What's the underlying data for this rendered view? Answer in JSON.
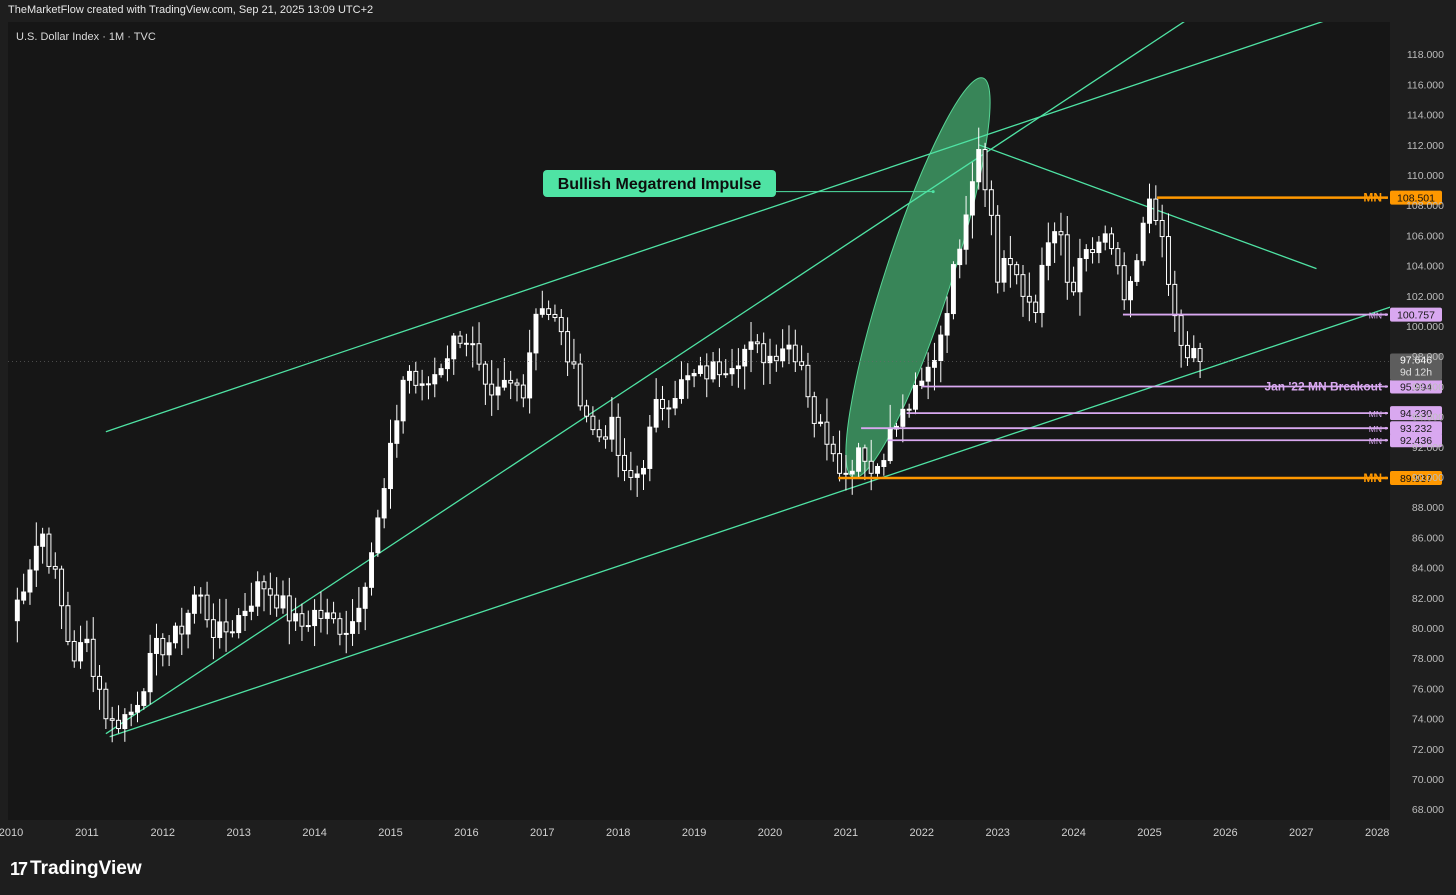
{
  "header": {
    "credit": "TheMarketFlow created with TradingView.com, Sep 21, 2025 13:09 UTC+2"
  },
  "symbol": {
    "title": "U.S. Dollar Index · 1M · TVC"
  },
  "branding": {
    "logo_mark": "17",
    "logo_text": "TradingView"
  },
  "colors": {
    "background": "#161616",
    "candle": "#ffffff",
    "trendline": "#4fe3a4",
    "mn_orange": "#ff9800",
    "mn_pink": "#d9a8f0",
    "ellipse_fill": "#3f9d66"
  },
  "chart_data": {
    "type": "candlestick",
    "title": "U.S. Dollar Index · 1M · TVC",
    "x_ticks": [
      "2010",
      "2011",
      "2012",
      "2013",
      "2014",
      "2015",
      "2016",
      "2017",
      "2018",
      "2019",
      "2020",
      "2021",
      "2022",
      "2023",
      "2024",
      "2025",
      "2026",
      "2027",
      "2028"
    ],
    "y_ticks": [
      "68.000",
      "70.000",
      "72.000",
      "74.000",
      "76.000",
      "78.000",
      "80.000",
      "82.000",
      "84.000",
      "86.000",
      "88.000",
      "90.000",
      "92.000",
      "94.000",
      "96.000",
      "98.000",
      "100.000",
      "102.000",
      "104.000",
      "106.000",
      "108.000",
      "110.000",
      "112.000",
      "114.000",
      "116.000",
      "118.000",
      "120.000"
    ],
    "ylim": [
      67.5,
      120.3
    ],
    "last_price": {
      "value": "97.646",
      "countdown": "9d 12h"
    },
    "anchors": [
      [
        2010.0,
        80.5
      ],
      [
        2010.4,
        86.5
      ],
      [
        2010.6,
        83.0
      ],
      [
        2010.8,
        78.0
      ],
      [
        2011.0,
        79.0
      ],
      [
        2011.3,
        73.5
      ],
      [
        2011.6,
        74.5
      ],
      [
        2011.9,
        78.5
      ],
      [
        2012.2,
        79.5
      ],
      [
        2012.45,
        82.5
      ],
      [
        2012.7,
        79.5
      ],
      [
        2012.9,
        80.0
      ],
      [
        2013.3,
        83.0
      ],
      [
        2013.5,
        82.0
      ],
      [
        2013.8,
        80.0
      ],
      [
        2014.0,
        81.0
      ],
      [
        2014.4,
        80.0
      ],
      [
        2014.5,
        80.5
      ],
      [
        2014.7,
        84.0
      ],
      [
        2014.9,
        88.5
      ],
      [
        2015.2,
        97.5
      ],
      [
        2015.4,
        95.5
      ],
      [
        2015.6,
        97.0
      ],
      [
        2015.9,
        99.5
      ],
      [
        2016.05,
        99.0
      ],
      [
        2016.3,
        94.5
      ],
      [
        2016.5,
        96.0
      ],
      [
        2016.75,
        96.0
      ],
      [
        2016.95,
        102.0
      ],
      [
        2017.2,
        100.0
      ],
      [
        2017.5,
        95.5
      ],
      [
        2017.7,
        92.5
      ],
      [
        2017.9,
        93.5
      ],
      [
        2018.1,
        89.5
      ],
      [
        2018.3,
        90.5
      ],
      [
        2018.5,
        94.5
      ],
      [
        2018.8,
        96.0
      ],
      [
        2018.95,
        96.5
      ],
      [
        2019.3,
        97.2
      ],
      [
        2019.7,
        98.5
      ],
      [
        2020.0,
        98.0
      ],
      [
        2020.2,
        99.0
      ],
      [
        2020.4,
        98.0
      ],
      [
        2020.6,
        93.5
      ],
      [
        2020.8,
        92.5
      ],
      [
        2021.0,
        90.0
      ],
      [
        2021.2,
        92.5
      ],
      [
        2021.35,
        90.0
      ],
      [
        2021.55,
        92.5
      ],
      [
        2021.8,
        94.5
      ],
      [
        2022.0,
        96.0
      ],
      [
        2022.2,
        98.5
      ],
      [
        2022.4,
        103.0
      ],
      [
        2022.6,
        108.5
      ],
      [
        2022.75,
        112.0
      ],
      [
        2022.9,
        108.0
      ],
      [
        2023.0,
        103.0
      ],
      [
        2023.1,
        105.0
      ],
      [
        2023.3,
        102.0
      ],
      [
        2023.5,
        101.5
      ],
      [
        2023.7,
        106.0
      ],
      [
        2023.8,
        106.5
      ],
      [
        2023.95,
        101.5
      ],
      [
        2024.1,
        104.0
      ],
      [
        2024.4,
        106.0
      ],
      [
        2024.55,
        104.0
      ],
      [
        2024.7,
        101.0
      ],
      [
        2024.85,
        104.5
      ],
      [
        2025.0,
        108.5
      ],
      [
        2025.1,
        107.5
      ],
      [
        2025.2,
        104.0
      ],
      [
        2025.35,
        100.0
      ],
      [
        2025.5,
        97.5
      ],
      [
        2025.65,
        98.5
      ],
      [
        2025.72,
        97.6
      ]
    ],
    "trendlines": [
      {
        "name": "channel-upper",
        "p1": [
          2011.25,
          73.0
        ],
        "p2": [
          2023.0,
          112.0
        ],
        "extend": true
      },
      {
        "name": "channel-lower",
        "p1": [
          2011.3,
          72.8
        ],
        "p2": [
          2021.5,
          90.0
        ],
        "extend": true
      },
      {
        "name": "upper-left",
        "p1": [
          2011.25,
          93.0
        ],
        "p2": [
          2022.7,
          112.4
        ],
        "extend": true
      },
      {
        "name": "descending",
        "p1": [
          2022.75,
          112.0
        ],
        "p2": [
          2027.2,
          103.8
        ],
        "extend": false
      }
    ],
    "levels": [
      {
        "label": "MN",
        "value": "108.501",
        "color": "#ff9800",
        "from": 2025.1
      },
      {
        "label": "MN",
        "value": "100.757",
        "color": "#d9a8f0",
        "from": 2024.65
      },
      {
        "label": "Jan '22 MN Breakout",
        "value": "95.994",
        "color": "#d9a8f0",
        "from": 2022.0
      },
      {
        "label": "MN",
        "value": "94.230",
        "color": "#d9a8f0",
        "from": 2021.8
      },
      {
        "label": "MN",
        "value": "93.232",
        "color": "#d9a8f0",
        "from": 2021.2
      },
      {
        "label": "MN",
        "value": "92.436",
        "color": "#d9a8f0",
        "from": 2021.55
      },
      {
        "label": "MN",
        "value": "89.937",
        "color": "#ff9800",
        "from": 2020.9
      }
    ],
    "annotations": [
      {
        "text": "Bullish Megatrend Impulse",
        "points_to": [
          2022.15,
          108.9
        ]
      }
    ]
  }
}
